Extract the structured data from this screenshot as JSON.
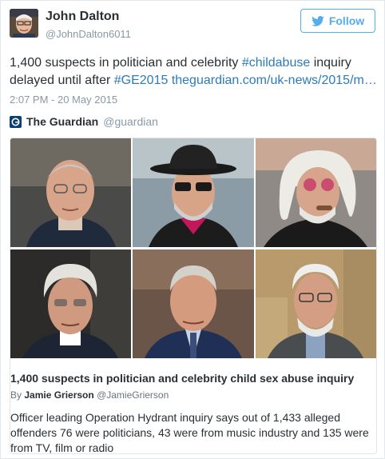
{
  "author": {
    "name": "John Dalton",
    "handle": "@JohnDalton6011"
  },
  "follow_button": {
    "label": "Follow"
  },
  "tweet": {
    "text_before": "1,400 suspects in politician and celebrity ",
    "hashtag1": "#childabuse",
    "text_middle": " inquiry delayed until after ",
    "hashtag2": "#GE2015",
    "link": "theguardian.com/uk-news/2015/m…",
    "timestamp": "2:07 PM - 20 May 2015"
  },
  "card": {
    "source_name": "The Guardian",
    "source_handle": "@guardian",
    "title": "1,400 suspects in politician and celebrity child sex abuse inquiry",
    "byline_prefix": "By ",
    "byline_author": "Jamie Grierson",
    "byline_handle": "@JamieGrierson",
    "description": "Officer leading Operation Hydrant inquiry says out of 1,433 alleged offenders 76 were politicians, 43 were from music industry and 135 were from TV, film or radio"
  },
  "colors": {
    "link": "#2b7bb9",
    "follow": "#55acee",
    "muted": "#8899a6",
    "guardian": "#0b3f72"
  },
  "icons": [
    "twitter-bird-icon",
    "guardian-logo-icon"
  ]
}
